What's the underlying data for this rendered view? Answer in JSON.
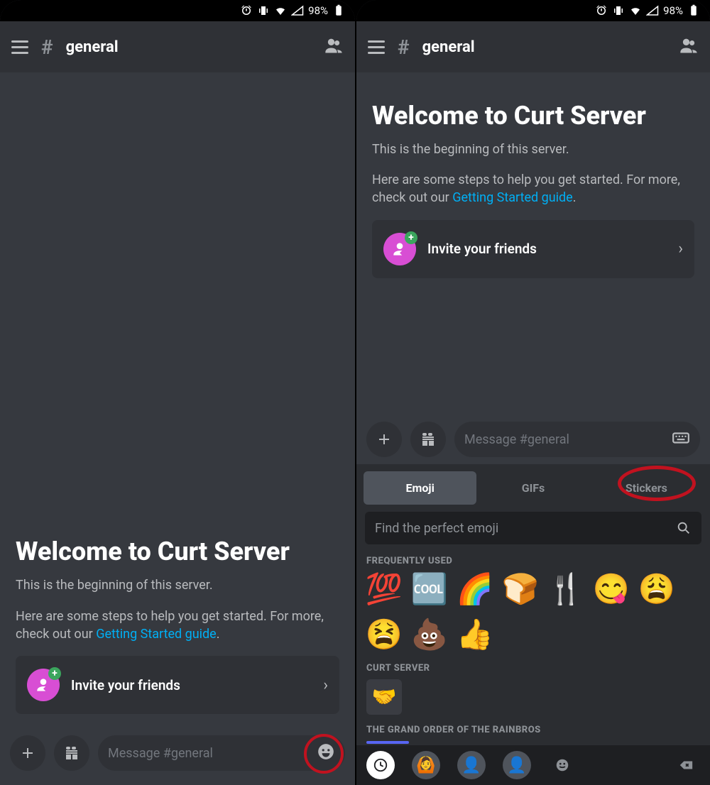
{
  "statusbar": {
    "battery_pct": "98%"
  },
  "header": {
    "channel_name": "general"
  },
  "welcome": {
    "title": "Welcome to Curt Server",
    "subtitle": "This is the beginning of this server.",
    "help_prefix": "Here are some steps to help you get started. For more, check out our ",
    "help_link": "Getting Started guide",
    "help_suffix": ".",
    "invite_label": "Invite your friends"
  },
  "input": {
    "placeholder": "Message #general"
  },
  "emoji_panel": {
    "tabs": {
      "emoji": "Emoji",
      "gifs": "GIFs",
      "stickers": "Stickers"
    },
    "search_placeholder": "Find the perfect emoji",
    "sections": {
      "frequent": "FREQUENTLY USED",
      "server1": "CURT SERVER",
      "server2": "THE GRAND ORDER OF THE RAINBROS"
    },
    "frequent": [
      "💯",
      "🆒",
      "🌈",
      "🍞",
      "🍴",
      "😋",
      "😩",
      "😫",
      "💩",
      "👍"
    ]
  }
}
